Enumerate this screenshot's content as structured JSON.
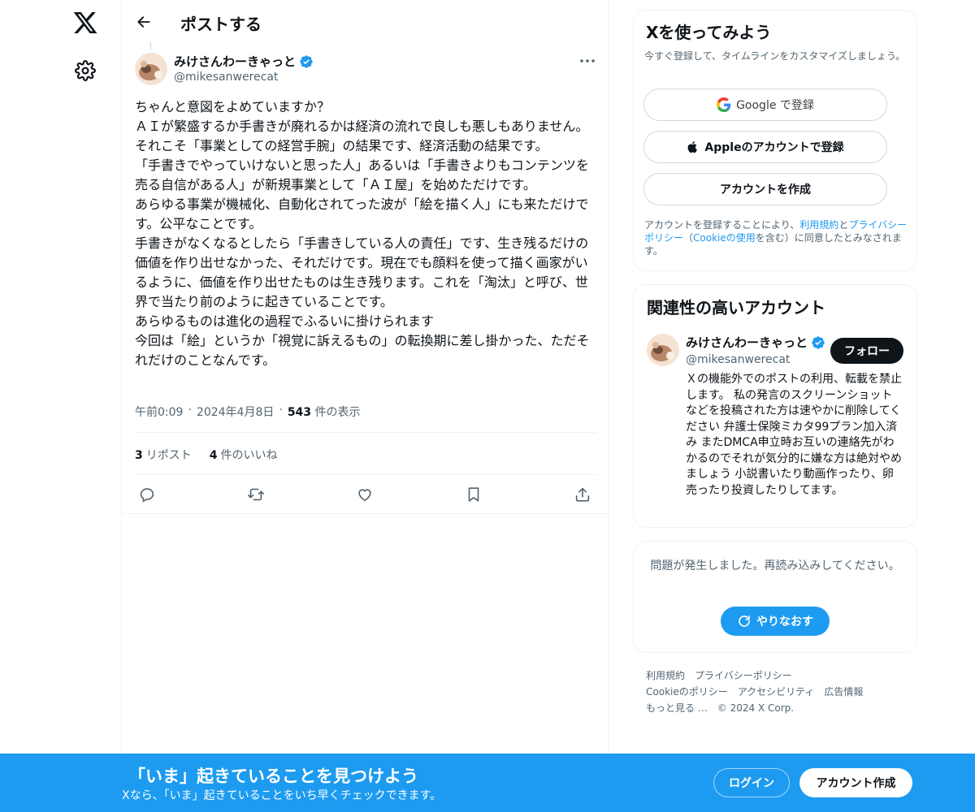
{
  "header": {
    "title": "ポストする"
  },
  "post": {
    "author_name": "みけさんわーきゃっと",
    "author_handle": "@mikesanwerecat",
    "body": "ちゃんと意図をよめていますか？\nＡＩが繁盛するか手書きが廃れるかは経済の流れで良しも悪しもありません。それこそ「事業としての経営手腕」の結果です、経済活動の結果です。\n「手書きでやっていけないと思った人」あるいは「手書きよりもコンテンツを売る自信がある人」が新規事業として「ＡＩ屋」を始めただけです。\nあらゆる事業が機械化、自動化されてった波が「絵を描く人」にも来ただけです。公平なことです。\n手書きがなくなるとしたら「手書きしている人の責任」です、生き残るだけの価値を作り出せなかった、それだけです。現在でも顔料を使って描く画家がいるように、価値を作り出せたものは生き残ります。これを「淘汰」と呼び、世界で当たり前のように起きていることです。\nあらゆるものは進化の過程でふるいに掛けられます\n今回は「絵」というか「視覚に訴えるもの」の転換期に差し掛かった、ただそれだけのことなんです。",
    "time": "午前0:09",
    "date": "2024年4月8日",
    "separator": "·",
    "views_count": "543",
    "views_label": "件の表示",
    "reposts_count": "3",
    "reposts_label": "リポスト",
    "likes_count": "4",
    "likes_label": "件のいいね"
  },
  "signup": {
    "title": "Xを使ってみよう",
    "subtitle": "今すぐ登録して、タイムラインをカスタマイズしましょう。",
    "google_label": "Google で登録",
    "apple_label": "Appleのアカウントで登録",
    "create_label": "アカウントを作成",
    "terms_prefix": "アカウントを登録することにより、",
    "terms_link1": "利用規約",
    "terms_and": "と",
    "terms_link2": "プライバシーポリシー",
    "terms_paren_open": "（",
    "terms_link3": "Cookieの使用",
    "terms_suffix": "を含む）に同意したとみなされます。"
  },
  "related": {
    "title": "関連性の高いアカウント",
    "name": "みけさんわーきゃっと",
    "handle": "@mikesanwerecat",
    "follow_label": "フォロー",
    "bio": "Ｘの機能外でのポストの利用、転載を禁止します。 私の発言のスクリーンショットなどを投稿された方は速やかに削除してください 弁護士保険ミカタ99プラン加入済み またDMCA申立時お互いの連絡先がわかるのでそれが気分的に嫌な方は絶対やめましょう 小説書いたり動画作ったり、卵売ったり投資したりしてます。"
  },
  "error_card": {
    "message": "問題が発生しました。再読み込みしてください。",
    "retry_label": "やりなおす"
  },
  "footer": {
    "terms": "利用規約",
    "privacy": "プライバシーポリシー",
    "cookie": "Cookieのポリシー",
    "accessibility": "アクセシビリティ",
    "ads": "広告情報",
    "more": "もっと見る …",
    "copyright": "© 2024 X Corp."
  },
  "bottom_bar": {
    "title": "「いま」起きていることを見つけよう",
    "subtitle": "Xなら、「いま」起きていることをいち早くチェックできます。",
    "login_label": "ログイン",
    "create_label": "アカウント作成"
  },
  "colors": {
    "accent": "#1d9bf0",
    "text": "#0f1419",
    "muted": "#536471",
    "border": "#eff3f4"
  },
  "icons": {
    "logo": "x-logo-icon",
    "settings": "gear-icon",
    "back": "arrow-left-icon",
    "verified": "verified-badge-icon",
    "more": "more-horizontal-icon",
    "reply": "reply-icon",
    "repost": "repost-icon",
    "like": "heart-icon",
    "bookmark": "bookmark-icon",
    "share": "share-icon",
    "google": "google-icon",
    "apple": "apple-icon",
    "refresh": "refresh-icon"
  }
}
